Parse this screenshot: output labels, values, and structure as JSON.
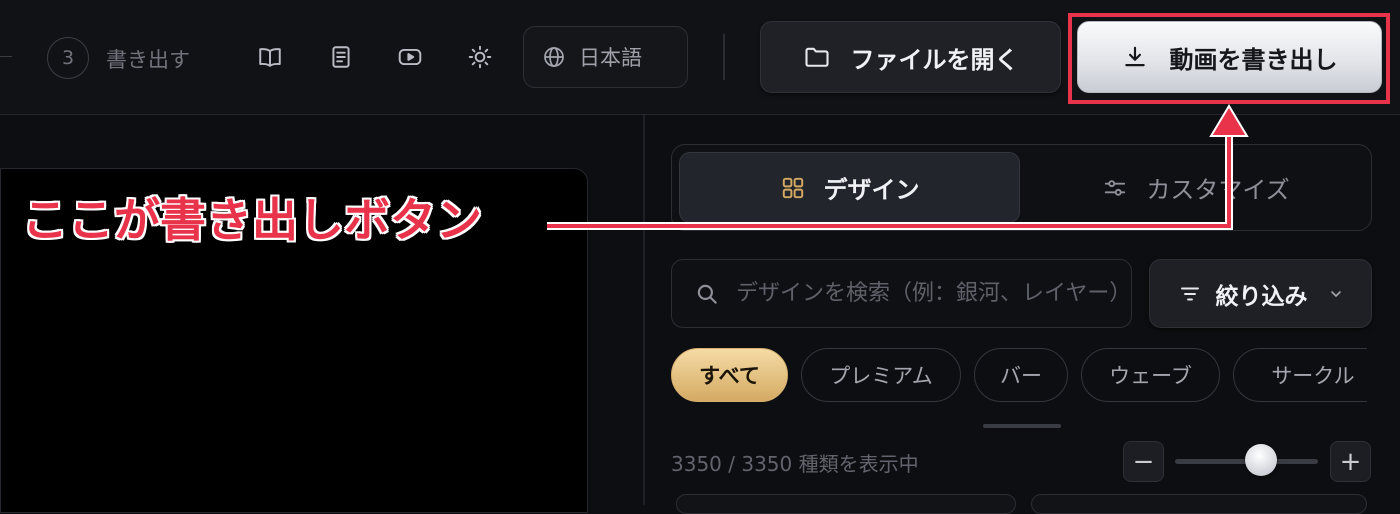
{
  "colors": {
    "background": "#0d0e11",
    "accent_gold": "#d4aa63",
    "annotation_red": "#e8334a",
    "export_button": "#e3e5ea"
  },
  "header": {
    "step_number": "3",
    "step_label": "書き出す",
    "icons": [
      "book-icon",
      "document-icon",
      "youtube-icon",
      "sun-icon"
    ],
    "language": {
      "icon": "globe-icon",
      "label": "日本語"
    },
    "open_file": {
      "icon": "folder-icon",
      "label": "ファイルを開く"
    },
    "export_video": {
      "icon": "download-icon",
      "label": "動画を書き出し"
    }
  },
  "annotation": {
    "text": "ここが書き出しボタン"
  },
  "panel": {
    "tabs": [
      {
        "icon": "grid-icon",
        "label": "デザイン",
        "active": true
      },
      {
        "icon": "sliders-icon",
        "label": "カスタマイズ",
        "active": false
      }
    ],
    "search": {
      "icon": "search-icon",
      "placeholder": "デザインを検索（例：銀河、レイヤー）",
      "value": ""
    },
    "filter": {
      "icon": "filter-icon",
      "label": "絞り込み",
      "chevron": "chevron-down-icon"
    },
    "chips": [
      {
        "label": "すべて",
        "active": true
      },
      {
        "label": "プレミアム",
        "active": false
      },
      {
        "label": "バー",
        "active": false
      },
      {
        "label": "ウェーブ",
        "active": false
      },
      {
        "label": "サークル",
        "active": false
      }
    ],
    "count_text": "3350 / 3350 種類を表示中",
    "zoom": {
      "minus": "−",
      "plus": "+",
      "level": 0.6
    }
  }
}
